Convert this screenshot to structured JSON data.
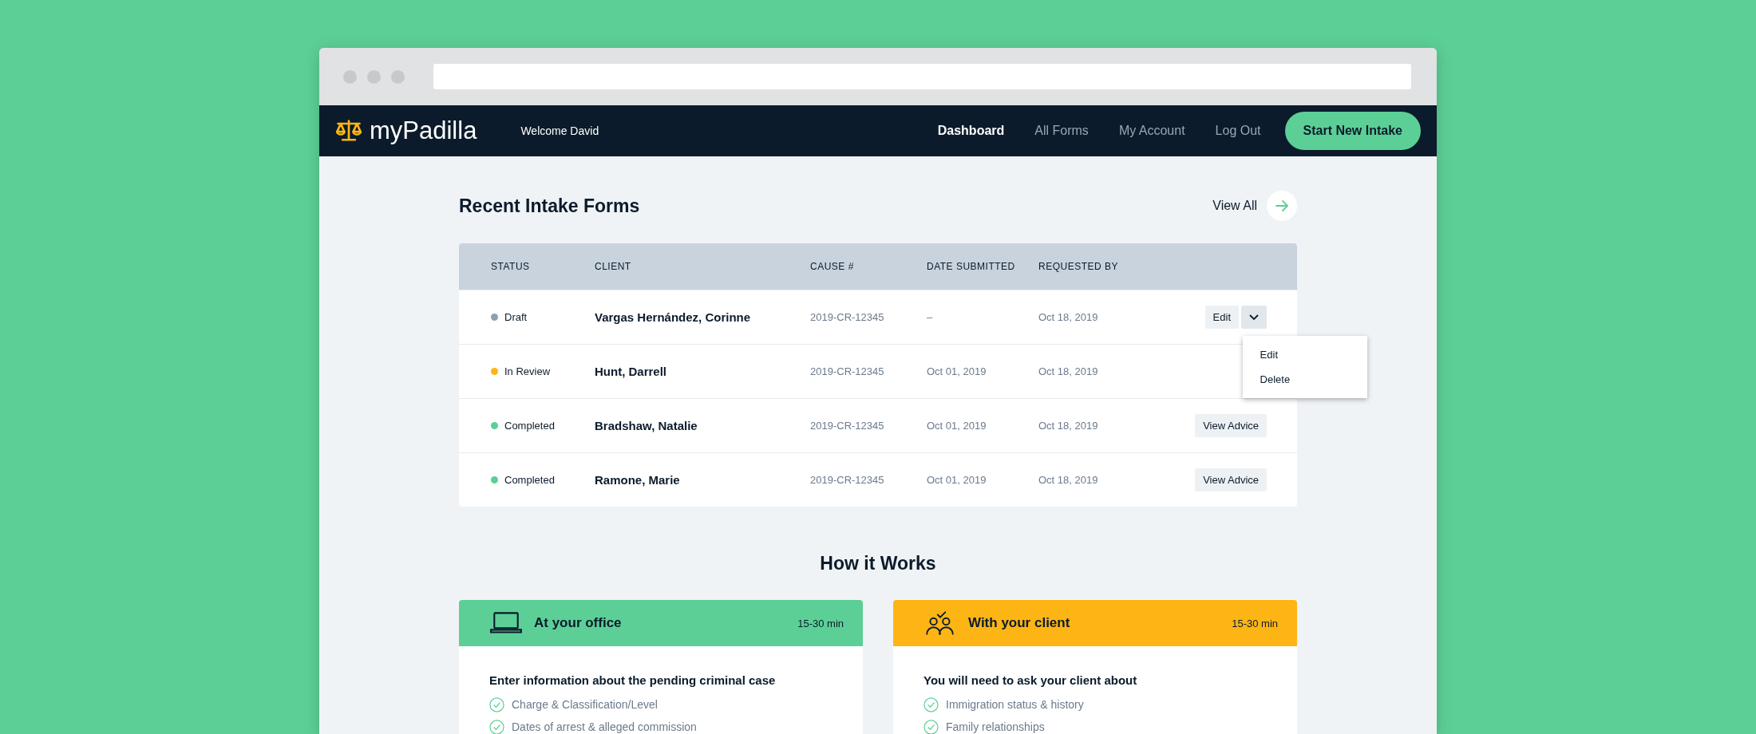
{
  "brand": {
    "name": "myPadilla"
  },
  "welcome": "Welcome David",
  "nav": [
    {
      "label": "Dashboard",
      "selected": true
    },
    {
      "label": "All Forms",
      "selected": false
    },
    {
      "label": "My Account",
      "selected": false
    },
    {
      "label": "Log Out",
      "selected": false
    }
  ],
  "cta": "Start New Intake",
  "recent": {
    "title": "Recent Intake Forms",
    "view_all": "View All",
    "columns": [
      "STATUS",
      "CLIENT",
      "CAUSE #",
      "DATE SUBMITTED",
      "REQUESTED BY"
    ],
    "rows": [
      {
        "status": "Draft",
        "color": "#8fa0b3",
        "client": "Vargas Hernández, Corinne",
        "cause": "2019-CR-12345",
        "submitted": "–",
        "requested": "Oct 18, 2019",
        "action": {
          "kind": "edit",
          "label": "Edit",
          "expanded": true,
          "menu": [
            "Edit",
            "Delete"
          ]
        }
      },
      {
        "status": "In Review",
        "color": "#fdb515",
        "client": "Hunt, Darrell",
        "cause": "2019-CR-12345",
        "submitted": "Oct 01, 2019",
        "requested": "Oct 18, 2019"
      },
      {
        "status": "Completed",
        "color": "#5ccf96",
        "client": "Bradshaw, Natalie",
        "cause": "2019-CR-12345",
        "submitted": "Oct 01, 2019",
        "requested": "Oct 18, 2019",
        "action": {
          "kind": "view",
          "label": "View Advice"
        }
      },
      {
        "status": "Completed",
        "color": "#5ccf96",
        "client": "Ramone, Marie",
        "cause": "2019-CR-12345",
        "submitted": "Oct 01, 2019",
        "requested": "Oct 18, 2019",
        "action": {
          "kind": "view",
          "label": "View Advice"
        }
      }
    ]
  },
  "how": {
    "title": "How it Works",
    "cards": [
      {
        "kind": "office",
        "color": "#5ccf96",
        "title": "At your office",
        "time": "15-30 min",
        "lead": "Enter information about the pending criminal case",
        "items": [
          "Charge & Classification/Level",
          "Dates of arrest & alleged commission"
        ]
      },
      {
        "kind": "client",
        "color": "#fdb515",
        "title": "With your client",
        "time": "15-30 min",
        "lead": "You will need to ask your client about",
        "items": [
          "Immigration status & history",
          "Family relationships"
        ]
      }
    ]
  }
}
